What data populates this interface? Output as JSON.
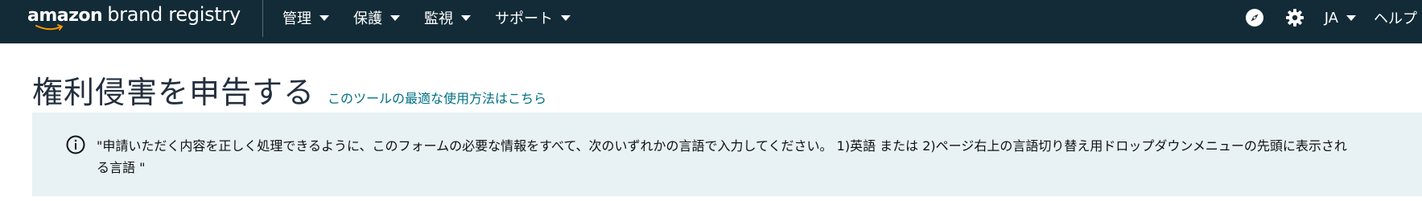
{
  "header": {
    "logo": {
      "amazon": "amazon",
      "rest": "brand registry"
    },
    "nav_items": [
      {
        "label": "管理"
      },
      {
        "label": "保護"
      },
      {
        "label": "監視"
      },
      {
        "label": "サポート"
      }
    ],
    "icons": {
      "compass": "compass-icon",
      "settings": "gear-icon"
    },
    "language": "JA",
    "help": "ヘルプ"
  },
  "main": {
    "title": "権利侵害を申告する",
    "title_link": "このツールの最適な使用方法はこちら",
    "info_message": "\"申請いただく内容を正しく処理できるように、このフォームの必要な情報をすべて、次のいずれかの言語で入力してください。 1)英語 または 2)ページ右上の言語切り替え用ドロップダウンメニューの先頭に表示される言語 \""
  },
  "colors": {
    "header_bg": "#122b37",
    "info_bg": "#e8f1f3",
    "link": "#007185",
    "title": "#232f3e"
  }
}
